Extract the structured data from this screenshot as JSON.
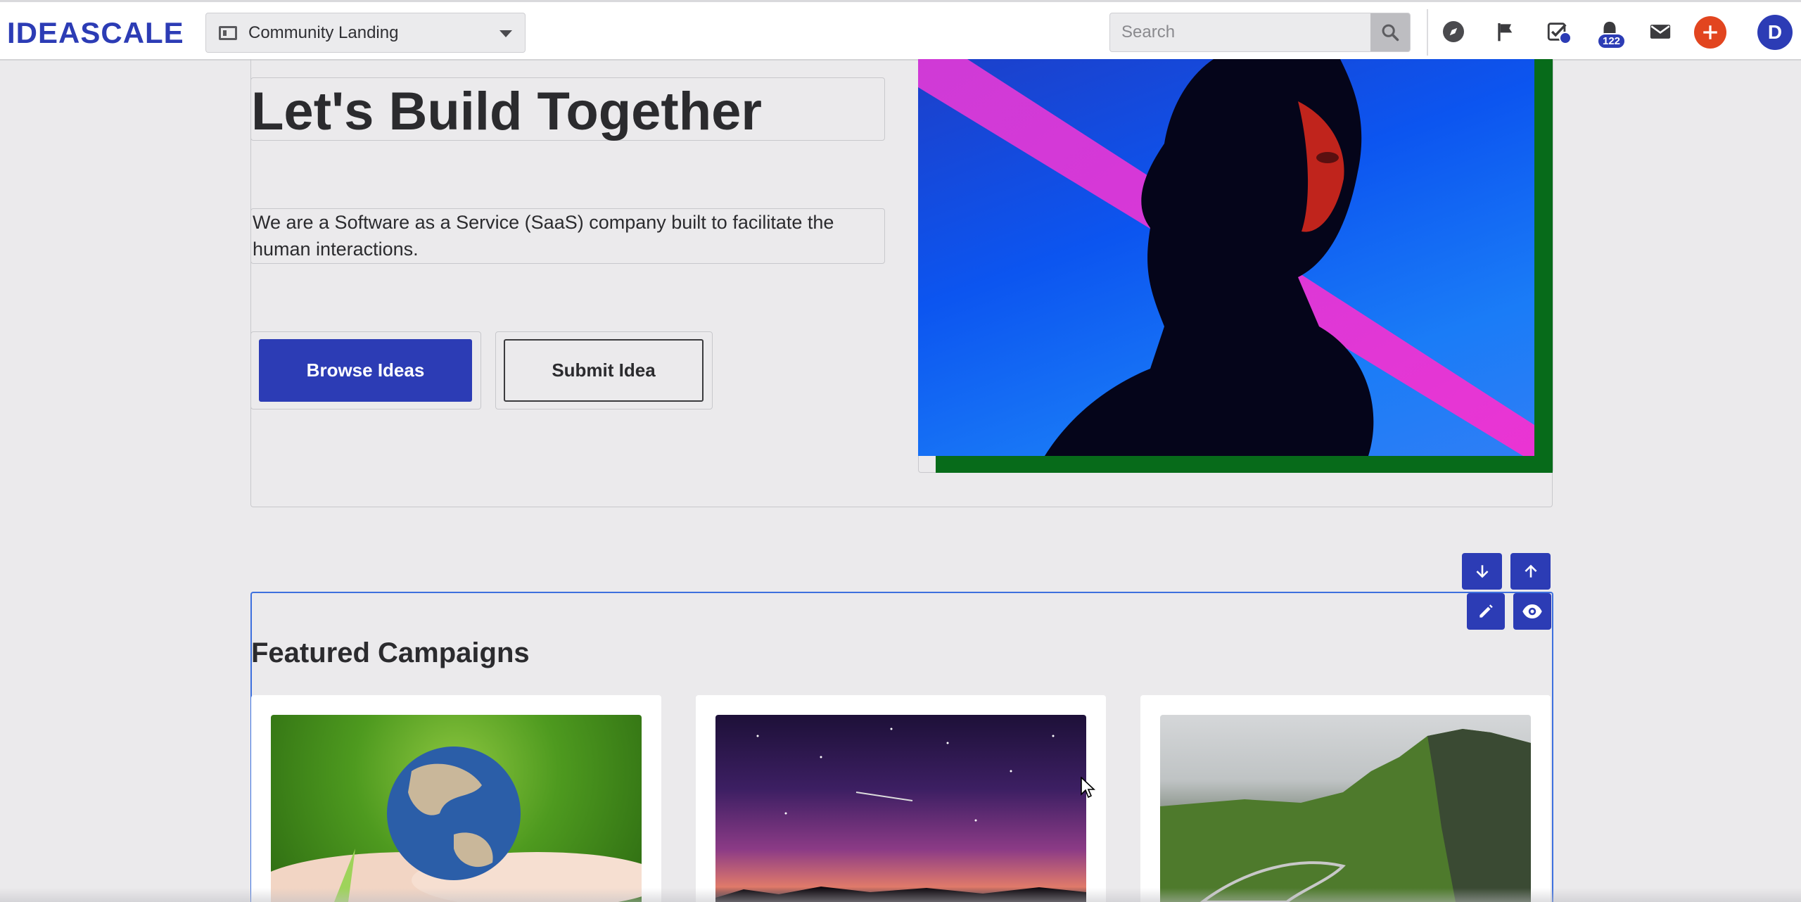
{
  "header": {
    "logo": "IDEASCALE",
    "page_selector": {
      "label": "Community Landing",
      "icon": "page-layout-icon"
    },
    "search": {
      "placeholder": "Search",
      "icon": "search-icon"
    },
    "nav_icons": [
      "compass-icon",
      "flag-icon",
      "tasks-icon",
      "bell-icon",
      "mail-icon"
    ],
    "notification_count": "122",
    "avatar_initial": "D",
    "colors": {
      "brand": "#2c3cb5",
      "add": "#e2451f"
    }
  },
  "hero": {
    "title": "Let's Build Together",
    "description": "We are a Software as a Service (SaaS) company built to facilitate the human interactions.",
    "buttons": {
      "primary": "Browse Ideas",
      "secondary": "Submit Idea"
    },
    "image_alt": "silhouette-portrait-image"
  },
  "section_controls": [
    "arrow-down-icon",
    "arrow-up-icon",
    "pencil-icon",
    "eye-icon"
  ],
  "featured": {
    "title": "Featured Campaigns",
    "cards": [
      {
        "image": "earth-in-hands-image"
      },
      {
        "image": "starry-night-sky-image"
      },
      {
        "image": "green-cliffs-landscape-image"
      }
    ]
  }
}
